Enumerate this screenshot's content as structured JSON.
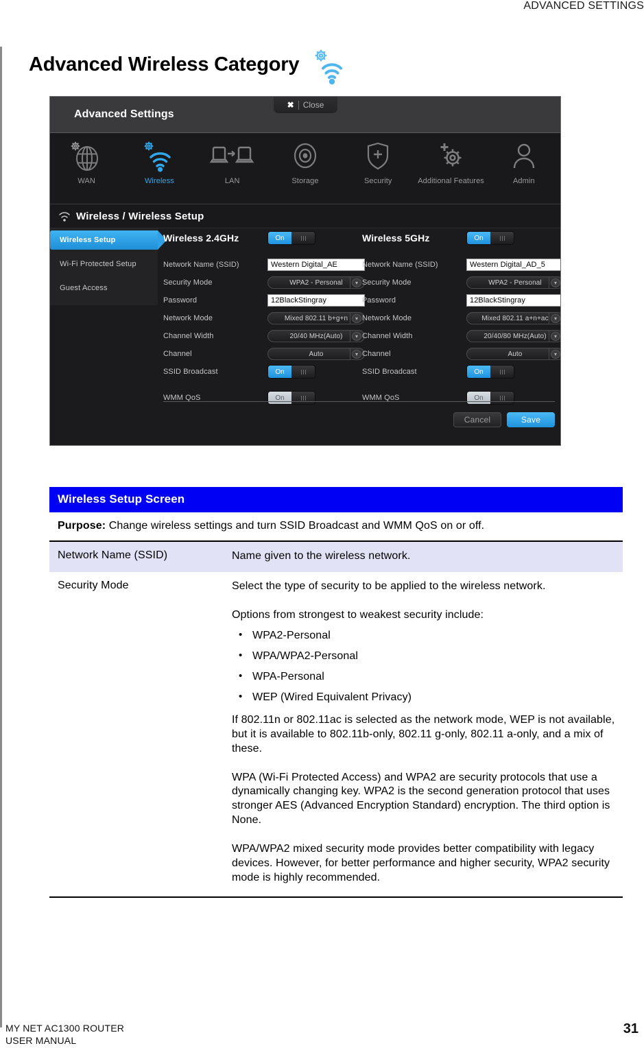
{
  "running_head": "ADVANCED SETTINGS",
  "page_title": "Advanced Wireless Category",
  "title_icon": "gear-wifi-icon",
  "screenshot": {
    "topbar_title": "Advanced Settings",
    "close_label": "Close",
    "close_icon": "close-x-icon",
    "nav": [
      {
        "label": "WAN",
        "icon": "globe-gear-icon",
        "active": false
      },
      {
        "label": "Wireless",
        "icon": "wifi-gear-icon",
        "active": true
      },
      {
        "label": "LAN",
        "icon": "two-computers-arrow-icon",
        "active": false
      },
      {
        "label": "Storage",
        "icon": "disk-platter-icon",
        "active": false
      },
      {
        "label": "Security",
        "icon": "shield-plus-icon",
        "active": false
      },
      {
        "label": "Additional Features",
        "icon": "gear-plus-icon",
        "active": false
      },
      {
        "label": "Admin",
        "icon": "person-icon",
        "active": false
      }
    ],
    "breadcrumb": "Wireless / Wireless Setup",
    "breadcrumb_icon": "wifi-small-icon",
    "sidebar": [
      {
        "label": "Wireless Setup",
        "active": true
      },
      {
        "label": "Wi-Fi Protected Setup",
        "active": false
      },
      {
        "label": "Guest Access",
        "active": false
      }
    ],
    "panels": [
      {
        "title": "Wireless 2.4GHz",
        "radio_toggle": {
          "label": "On",
          "state": "on"
        },
        "fields": [
          {
            "label": "Network Name (SSID)",
            "type": "text",
            "value": "Western Digital_AE"
          },
          {
            "label": "Security Mode",
            "type": "select",
            "value": "WPA2 - Personal"
          },
          {
            "label": "Password",
            "type": "text",
            "value": "12BlackStingray"
          },
          {
            "label": "Network Mode",
            "type": "select",
            "value": "Mixed 802.11 b+g+n"
          },
          {
            "label": "Channel Width",
            "type": "select",
            "value": "20/40 MHz(Auto)"
          },
          {
            "label": "Channel",
            "type": "select",
            "value": "Auto"
          },
          {
            "label": "SSID Broadcast",
            "type": "toggle",
            "value": "On",
            "state": "on"
          },
          {
            "label": "WMM QoS",
            "type": "toggle",
            "value": "On",
            "state": "on-disabled"
          }
        ]
      },
      {
        "title": "Wireless 5GHz",
        "radio_toggle": {
          "label": "On",
          "state": "on"
        },
        "fields": [
          {
            "label": "Network Name (SSID)",
            "type": "text",
            "value": "Western Digital_AD_5"
          },
          {
            "label": "Security Mode",
            "type": "select",
            "value": "WPA2 - Personal"
          },
          {
            "label": "Password",
            "type": "text",
            "value": "12BlackStingray"
          },
          {
            "label": "Network Mode",
            "type": "select",
            "value": "Mixed 802.11 a+n+ac"
          },
          {
            "label": "Channel Width",
            "type": "select",
            "value": "20/40/80 MHz(Auto)"
          },
          {
            "label": "Channel",
            "type": "select",
            "value": "Auto"
          },
          {
            "label": "SSID Broadcast",
            "type": "toggle",
            "value": "On",
            "state": "on"
          },
          {
            "label": "WMM QoS",
            "type": "toggle",
            "value": "On",
            "state": "on-disabled"
          }
        ]
      }
    ],
    "cancel_label": "Cancel",
    "save_label": "Save"
  },
  "table": {
    "header": "Wireless Setup Screen",
    "purpose_label": "Purpose:",
    "purpose_text": " Change wireless settings and turn SSID Broadcast and WMM QoS on or off.",
    "rows": [
      {
        "term": "Network Name (SSID)",
        "paragraphs": [
          "Name given to the wireless network."
        ],
        "bullets": [],
        "paragraphs_after": []
      },
      {
        "term": "Security Mode",
        "paragraphs": [
          "Select the type of security to be applied to the wireless network.",
          "Options from strongest to weakest security include:"
        ],
        "bullets": [
          "WPA2-Personal",
          "WPA/WPA2-Personal",
          "WPA-Personal",
          "WEP (Wired Equivalent Privacy)"
        ],
        "paragraphs_after": [
          "If 802.11n or 802.11ac is selected as the network mode, WEP is not available, but it is available to 802.11b-only, 802.11 g-only, 802.11 a-only, and a mix of these.",
          "WPA (Wi-Fi Protected Access) and WPA2 are security protocols that use a dynamically changing key. WPA2 is the second generation protocol that uses stronger AES (Advanced Encryption Standard) encryption. The third option is None.",
          "WPA/WPA2 mixed security mode provides better compatibility with legacy devices. However, for better performance and higher security, WPA2 security mode is highly recommended."
        ]
      }
    ]
  },
  "footer": {
    "line1": "MY NET AC1300 ROUTER",
    "line2": "USER MANUAL",
    "page_number": "31"
  },
  "colors": {
    "accent_blue": "#2fa8ec",
    "table_header_blue": "#0000f5",
    "row_shade": "#e2e2f7"
  }
}
